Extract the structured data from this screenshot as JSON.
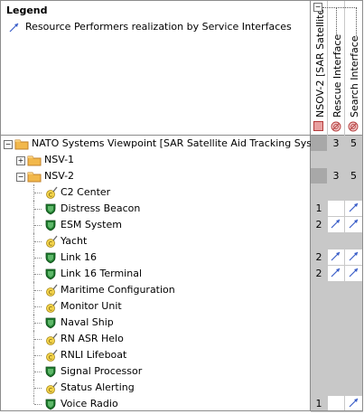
{
  "legend": {
    "title": "Legend",
    "items": [
      {
        "label": "Resource Performers realization by Service Interfaces",
        "icon": "blue-arrow-icon"
      }
    ]
  },
  "columns": [
    {
      "label": "NSOV-2 [SAR Satellite ...",
      "icon": "red-square-icon"
    },
    {
      "label": "Rescue Interface",
      "icon": "service-interface-icon"
    },
    {
      "label": "Search Interface",
      "icon": "service-interface-icon"
    }
  ],
  "rows": [
    {
      "label": "NATO Systems Viewpoint [SAR Satellite Aid Tracking System]",
      "icon": "folder-icon",
      "expander": "-",
      "indent": 0,
      "values": [
        "",
        "3",
        "5"
      ],
      "shade": "dark"
    },
    {
      "label": "NSV-1",
      "icon": "folder-icon",
      "expander": "+",
      "indent": 1,
      "values": [
        "",
        "",
        ""
      ],
      "shade": "gray"
    },
    {
      "label": "NSV-2",
      "icon": "folder-icon",
      "expander": "-",
      "indent": 1,
      "values": [
        "",
        "3",
        "5"
      ],
      "shade": "dark"
    },
    {
      "label": "C2 Center",
      "icon": "capability-icon",
      "indent": 2,
      "values": [
        "",
        "",
        ""
      ],
      "shade": "gray"
    },
    {
      "label": "Distress Beacon",
      "icon": "resource-shield-icon",
      "indent": 2,
      "values": [
        "1",
        "",
        "arrow"
      ]
    },
    {
      "label": "ESM System",
      "icon": "resource-shield-icon",
      "indent": 2,
      "values": [
        "2",
        "arrow",
        "arrow"
      ]
    },
    {
      "label": "Yacht",
      "icon": "capability-icon",
      "indent": 2,
      "values": [
        "",
        "",
        ""
      ],
      "shade": "gray"
    },
    {
      "label": "Link 16",
      "icon": "resource-shield-icon",
      "indent": 2,
      "values": [
        "2",
        "arrow",
        "arrow"
      ]
    },
    {
      "label": "Link 16 Terminal",
      "icon": "resource-shield-icon",
      "indent": 2,
      "values": [
        "2",
        "arrow",
        "arrow"
      ]
    },
    {
      "label": "Maritime Configuration",
      "icon": "capability-icon",
      "indent": 2,
      "values": [
        "",
        "",
        ""
      ],
      "shade": "gray"
    },
    {
      "label": "Monitor Unit",
      "icon": "capability-icon",
      "indent": 2,
      "values": [
        "",
        "",
        ""
      ],
      "shade": "gray"
    },
    {
      "label": "Naval Ship",
      "icon": "resource-shield-icon",
      "indent": 2,
      "values": [
        "",
        "",
        ""
      ],
      "shade": "gray"
    },
    {
      "label": "RN ASR Helo",
      "icon": "capability-icon",
      "indent": 2,
      "values": [
        "",
        "",
        ""
      ],
      "shade": "gray"
    },
    {
      "label": "RNLI Lifeboat",
      "icon": "capability-icon",
      "indent": 2,
      "values": [
        "",
        "",
        ""
      ],
      "shade": "gray"
    },
    {
      "label": "Signal Processor",
      "icon": "resource-shield-icon",
      "indent": 2,
      "values": [
        "",
        "",
        ""
      ],
      "shade": "gray"
    },
    {
      "label": "Status Alerting",
      "icon": "capability-icon",
      "indent": 2,
      "values": [
        "",
        "",
        ""
      ],
      "shade": "gray"
    },
    {
      "label": "Voice Radio",
      "icon": "resource-shield-icon",
      "indent": 2,
      "values": [
        "1",
        "",
        "arrow"
      ]
    }
  ],
  "colors": {
    "grid": "#c8c8c8",
    "arrow": "#3b5fc9",
    "folder": "#f2b84b",
    "shield": "#1f7a2e",
    "header-gray": "#c8c8c8"
  }
}
